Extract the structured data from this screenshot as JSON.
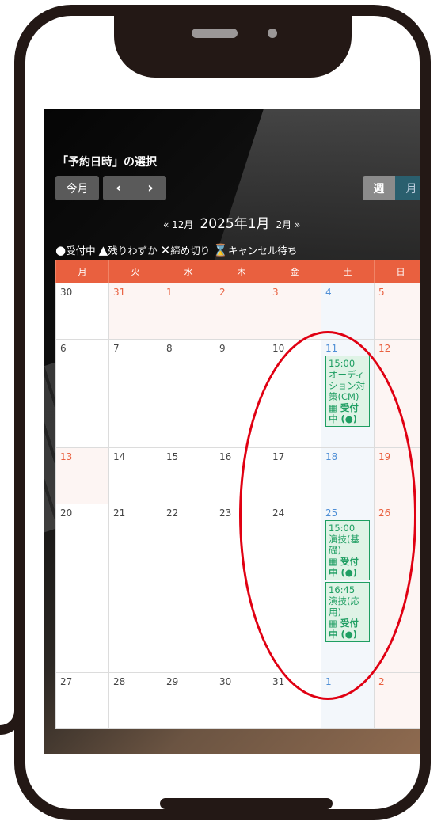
{
  "title": "「予約日時」の選択",
  "toolbar": {
    "today": "今月",
    "prev": "‹",
    "next": "›"
  },
  "view": {
    "week": "週",
    "month": "月"
  },
  "month_nav": {
    "prev": "« 12月",
    "current": "2025年1月",
    "next": "2月 »"
  },
  "legend": {
    "open_symbol": "●",
    "open": "受付中",
    "few_symbol": "▲",
    "few": "残りわずか",
    "closed_symbol": "✕",
    "closed": "締め切り",
    "wait_symbol": "⌛",
    "wait": "キャンセル待ち"
  },
  "weekdays": [
    "月",
    "火",
    "水",
    "木",
    "金",
    "土",
    "日"
  ],
  "weeks": [
    [
      "30",
      "31",
      "1",
      "2",
      "3",
      "4",
      "5"
    ],
    [
      "6",
      "7",
      "8",
      "9",
      "10",
      "11",
      "12"
    ],
    [
      "13",
      "14",
      "15",
      "16",
      "17",
      "18",
      "19"
    ],
    [
      "20",
      "21",
      "22",
      "23",
      "24",
      "25",
      "26"
    ],
    [
      "27",
      "28",
      "29",
      "30",
      "31",
      "1",
      "2"
    ]
  ],
  "events": {
    "jan11": {
      "time": "15:00",
      "name": "オーディション対策(CM)",
      "status": "受付中 (●)"
    },
    "jan25a": {
      "time": "15:00",
      "name": "演技(基礎)",
      "status": "受付中 (●)"
    },
    "jan25b": {
      "time": "16:45",
      "name": "演技(応用)",
      "status": "受付中 (●)"
    }
  },
  "colors": {
    "header": "#e9603f",
    "event": "#1e9e62",
    "highlight": "#e00012",
    "frame": "#231815"
  }
}
